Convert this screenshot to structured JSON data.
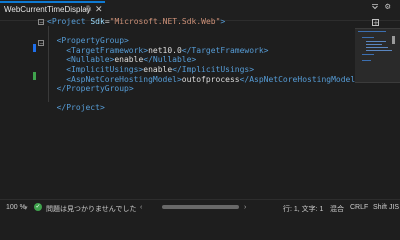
{
  "tab": {
    "title": "WebCurrentTimeDisplay",
    "pin_icon": "pin-icon",
    "close_icon": "close-icon"
  },
  "toolbar": {
    "overflow_icon": "chevron-down-icon",
    "settings_icon": "gear-icon"
  },
  "editor": {
    "lines": [
      {
        "indent": 0,
        "tokens": [
          {
            "t": "tg",
            "v": "<Project "
          },
          {
            "t": "an",
            "v": "Sdk"
          },
          {
            "t": "tx",
            "v": "="
          },
          {
            "t": "av",
            "v": "\"Microsoft.NET.Sdk.Web\""
          },
          {
            "t": "tg",
            "v": ">"
          }
        ]
      },
      {
        "indent": 0,
        "tokens": []
      },
      {
        "indent": 1,
        "tokens": [
          {
            "t": "tg",
            "v": "<PropertyGroup>"
          }
        ]
      },
      {
        "indent": 2,
        "tokens": [
          {
            "t": "tg",
            "v": "<TargetFramework>"
          },
          {
            "t": "tx",
            "v": "net10.0"
          },
          {
            "t": "tg",
            "v": "</TargetFramework>"
          }
        ]
      },
      {
        "indent": 2,
        "tokens": [
          {
            "t": "tg",
            "v": "<Nullable>"
          },
          {
            "t": "tx",
            "v": "enable"
          },
          {
            "t": "tg",
            "v": "</Nullable>"
          }
        ]
      },
      {
        "indent": 2,
        "tokens": [
          {
            "t": "tg",
            "v": "<ImplicitUsings>"
          },
          {
            "t": "tx",
            "v": "enable"
          },
          {
            "t": "tg",
            "v": "</ImplicitUsings>"
          }
        ]
      },
      {
        "indent": 2,
        "tokens": [
          {
            "t": "tg",
            "v": "<AspNetCoreHostingModel>"
          },
          {
            "t": "tx",
            "v": "outofprocess"
          },
          {
            "t": "tg",
            "v": "</AspNetCoreHostingModel>"
          }
        ]
      },
      {
        "indent": 1,
        "tokens": [
          {
            "t": "tg",
            "v": "</PropertyGroup>"
          }
        ]
      },
      {
        "indent": 0,
        "tokens": []
      },
      {
        "indent": 1,
        "tokens": [
          {
            "t": "tg",
            "v": "</Project>"
          }
        ]
      }
    ]
  },
  "status": {
    "zoom": "100 %",
    "issues": "問題は見つかりませんでした",
    "position": "行: 1, 文字: 1",
    "encoding": "混合",
    "line_ending": "CRLF",
    "charset": "Shift JIS",
    "ok_icon": "check-circle-icon"
  },
  "colors": {
    "accent": "#0e7ad3",
    "tag": "#569cd6",
    "attribute": "#9cdcfe",
    "string": "#ce9178",
    "change_saved": "#3fa34d",
    "change_unsaved": "#1f6feb"
  }
}
